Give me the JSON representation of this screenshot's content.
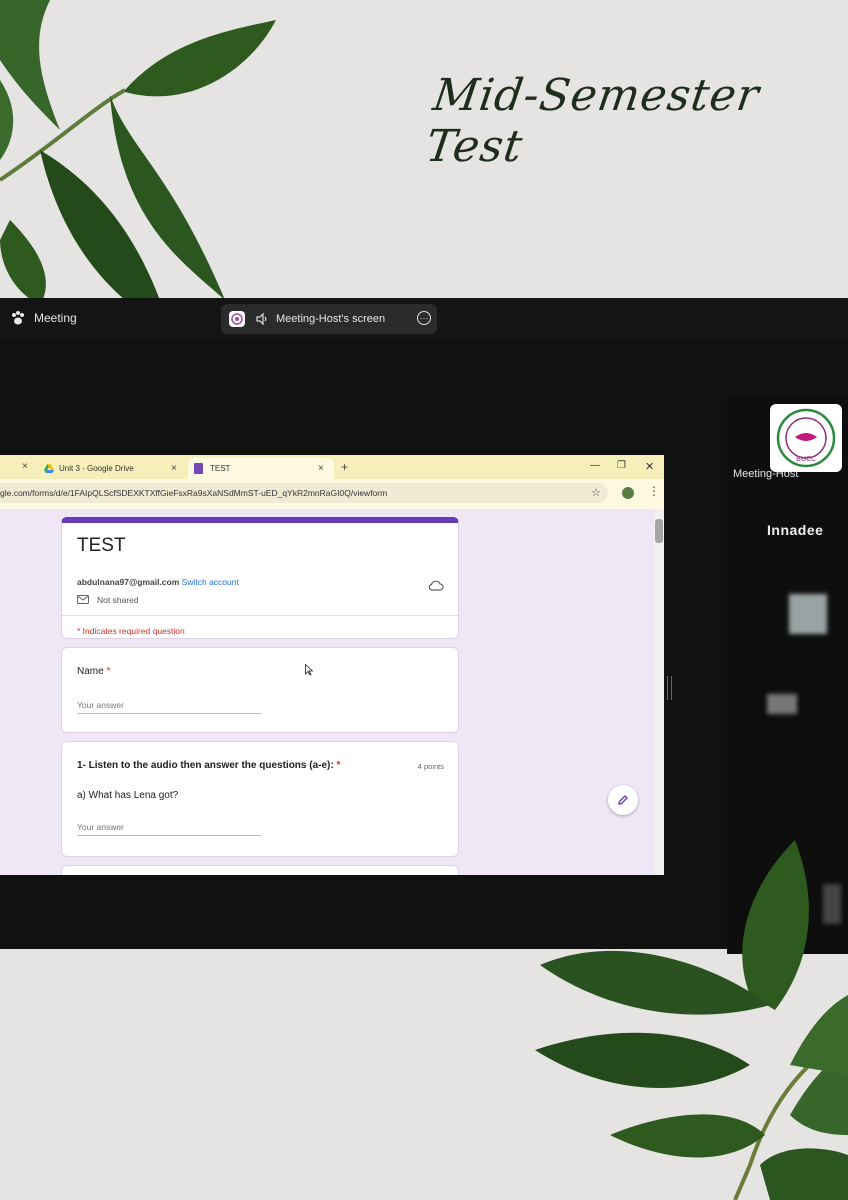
{
  "poster": {
    "title": "Mid-Semester Test"
  },
  "meeting": {
    "app_name": "Meeting",
    "share_label": "Meeting-Host's screen",
    "host_name": "Meeting-Host",
    "video_overlay_text": "Innadee",
    "avatar_text": "BUCC"
  },
  "browser": {
    "tabs": [
      {
        "label": ""
      },
      {
        "label": "Unit 3 - Google Drive"
      },
      {
        "label": "TEST"
      }
    ],
    "new_tab": "+",
    "url": "gle.com/forms/d/e/1FAIpQLScfSDEXKTXffGieFsxRa9sXaNSdMmST-uED_qYkR2mnRaGI0Q/viewform"
  },
  "form": {
    "title": "TEST",
    "account_email": "abdulnana97@gmail.com",
    "switch_account": "Switch account",
    "not_shared": "Not shared",
    "required_note": "* Indicates required question",
    "questions": [
      {
        "label": "Name",
        "required_mark": "*",
        "placeholder": "Your answer"
      },
      {
        "label": "1- Listen to the audio then answer the questions (a-e):",
        "required_mark": "*",
        "points": "4 points",
        "sub_question": "a) What has Lena got?",
        "placeholder": "Your answer"
      }
    ]
  },
  "colors": {
    "form_accent": "#673ab7",
    "form_background": "#efe6f6",
    "tabstrip": "#f7efb9",
    "meeting_background": "#111111",
    "poster_background": "#e6e4e2",
    "title_ink": "#1f2d1c"
  },
  "icons": {
    "meeting_app": "paw-icon",
    "speaker": "speaker-icon",
    "more": "more-icon",
    "drive": "google-drive-icon",
    "forms": "google-forms-icon",
    "star": "star-icon",
    "cloud": "cloud-saved-icon",
    "mail": "mail-icon",
    "edit": "pencil-icon"
  }
}
